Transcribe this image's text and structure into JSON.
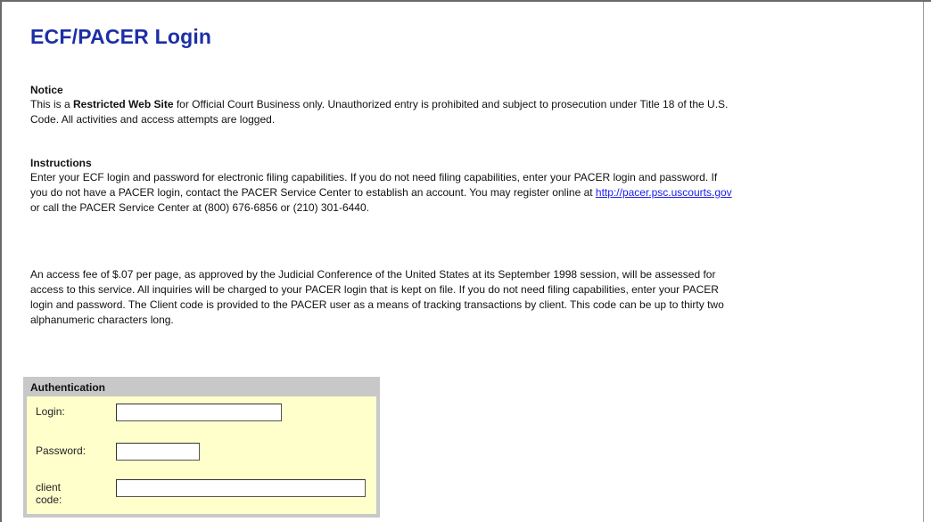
{
  "page": {
    "title": "ECF/PACER Login"
  },
  "notice": {
    "heading": "Notice",
    "text_prefix": "This is a ",
    "text_bold": "Restricted Web Site",
    "text_suffix": " for Official Court Business only. Unauthorized entry is prohibited and subject to prosecution under Title 18 of the U.S. Code. All activities and access attempts are logged."
  },
  "instructions": {
    "heading": "Instructions",
    "text_before_link": "Enter your ECF login and password for electronic filing capabilities. If you do not need filing capabilities, enter your PACER login and password. If you do not have a PACER login, contact the PACER Service Center to establish an account. You may register online at ",
    "link_text": "http://pacer.psc.uscourts.gov",
    "text_after_link": " or call the PACER Service Center at (800) 676-6856 or (210) 301-6440."
  },
  "fees": {
    "text": "An access fee of $.07 per page, as approved by the Judicial Conference of the United States at its September 1998 session, will be assessed for access to this service. All inquiries will be charged to your PACER login that is kept on file. If you do not need filing capabilities, enter your PACER login and password. The Client code is provided to the PACER user as a means of tracking transactions by client. This code can be up to thirty two alphanumeric characters long."
  },
  "auth": {
    "heading": "Authentication",
    "login_label": "Login:",
    "login_value": "",
    "password_label": "Password:",
    "password_value": "",
    "client_code_label": "client code:",
    "client_code_value": ""
  },
  "colors": {
    "title": "#1d2fa6",
    "link": "#1a1aee",
    "auth_box_bg": "#c8c8c8",
    "auth_inner_bg": "#ffffcc"
  }
}
